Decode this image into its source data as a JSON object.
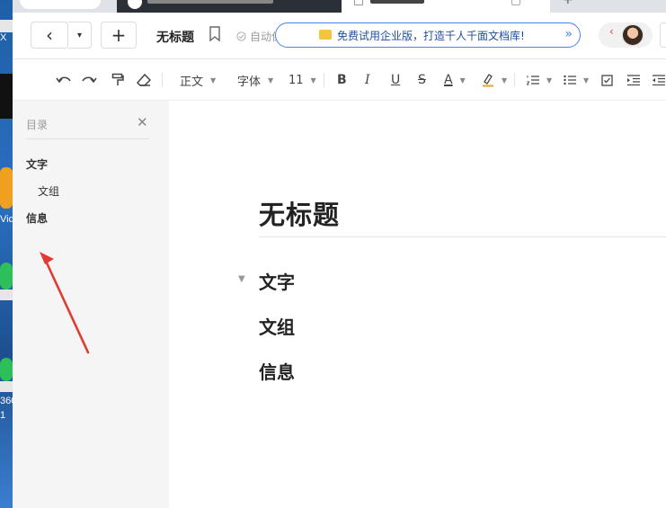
{
  "desktop": {
    "labels": [
      "X",
      "Vid",
      "360",
      "1"
    ]
  },
  "tabs": {
    "new_tab_label": "+"
  },
  "header": {
    "back_icon": "‹",
    "dropdown_icon": "▾",
    "new_icon": "+",
    "doc_title": "无标题",
    "autosave_text": "自动保存成功",
    "promo_text": "免费试用企业版，打造千人千面文档库!",
    "promo_arrows": "»",
    "avatar_chevron": "‹"
  },
  "toolbar": {
    "paragraph_style": "正文",
    "font_family": "字体",
    "font_size": "11",
    "bold": "B",
    "italic": "I",
    "underline": "U",
    "strike": "S",
    "font_color": "A"
  },
  "sidebar": {
    "title": "目录",
    "close_icon": "✕",
    "items": [
      {
        "label": "文字",
        "level": 1
      },
      {
        "label": "文组",
        "level": 2
      },
      {
        "label": "信息",
        "level": 1
      }
    ]
  },
  "document": {
    "title": "无标题",
    "headings": [
      "文字",
      "文组",
      "信息"
    ],
    "collapse_icon": "▼"
  },
  "colors": {
    "accent_blue": "#4a86e8",
    "arrow_red": "#e03c31",
    "sidebar_bg": "#f5f5f5"
  }
}
